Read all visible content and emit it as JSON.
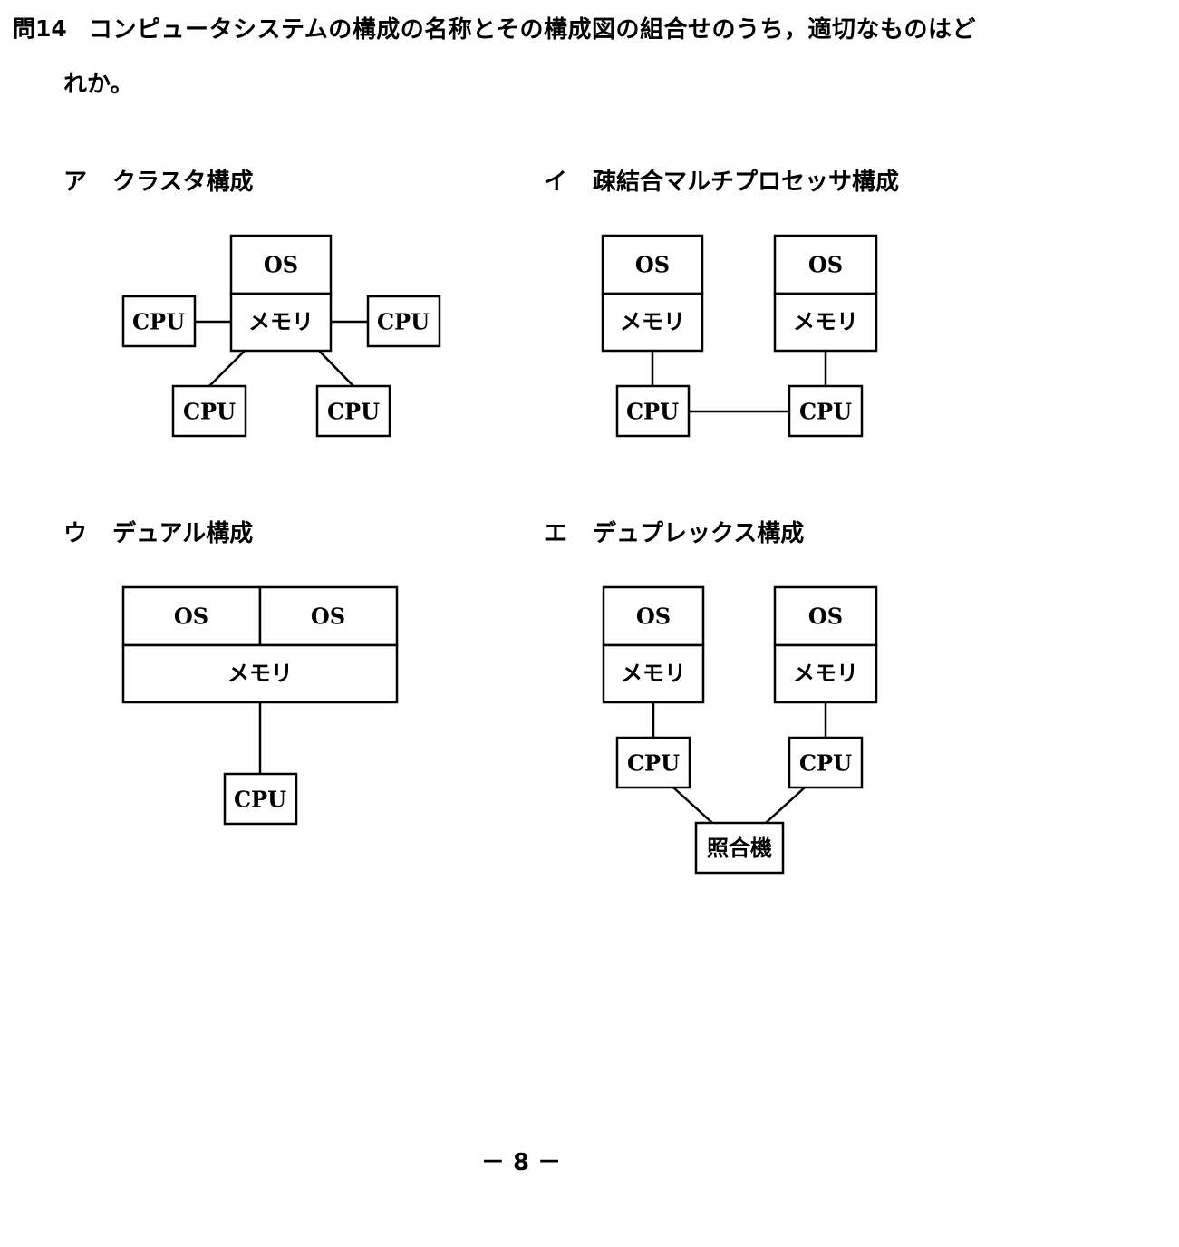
{
  "question": {
    "number": "問14",
    "text_line1": "コンピュータシステムの構成の名称とその構成図の組合せのうち，適切なものはど",
    "text_line2": "れか。"
  },
  "options": [
    {
      "letter": "ア",
      "name": "クラスタ構成",
      "diagram": {
        "os": "OS",
        "memory": "メモリ",
        "cpus": [
          "CPU",
          "CPU",
          "CPU",
          "CPU"
        ]
      }
    },
    {
      "letter": "イ",
      "name": "疎結合マルチプロセッサ構成",
      "diagram": {
        "left": {
          "os": "OS",
          "memory": "メモリ",
          "cpu": "CPU"
        },
        "right": {
          "os": "OS",
          "memory": "メモリ",
          "cpu": "CPU"
        }
      }
    },
    {
      "letter": "ウ",
      "name": "デュアル構成",
      "diagram": {
        "os_left": "OS",
        "os_right": "OS",
        "memory": "メモリ",
        "cpu": "CPU"
      }
    },
    {
      "letter": "エ",
      "name": "デュプレックス構成",
      "diagram": {
        "left": {
          "os": "OS",
          "memory": "メモリ",
          "cpu": "CPU"
        },
        "right": {
          "os": "OS",
          "memory": "メモリ",
          "cpu": "CPU"
        },
        "comparator": "照合機"
      }
    }
  ],
  "page_number": "－ 8 －"
}
